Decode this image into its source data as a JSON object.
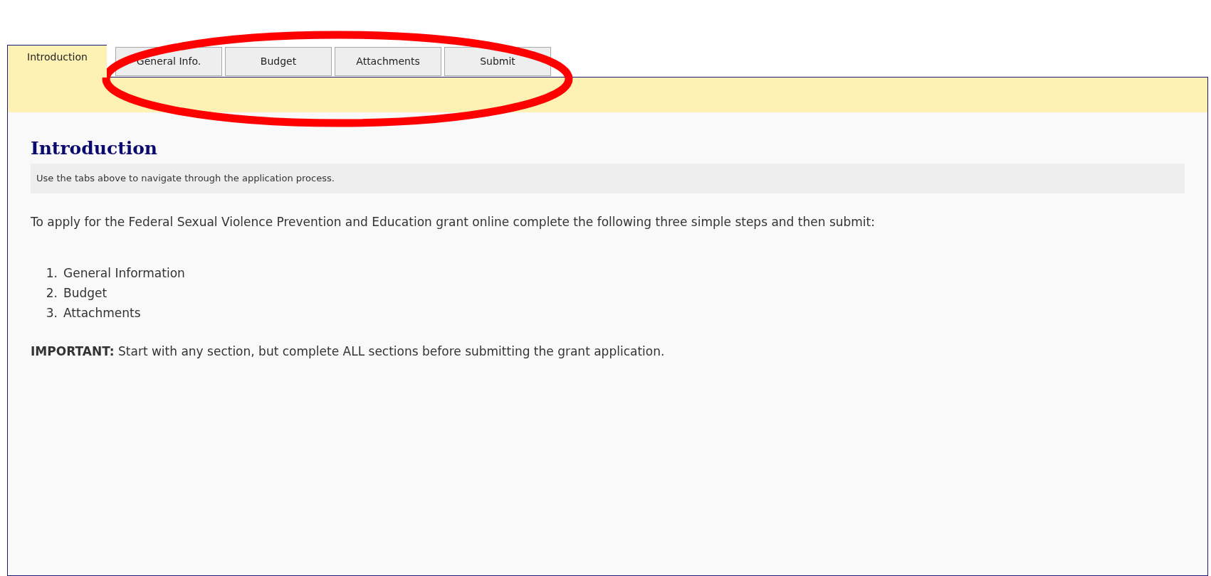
{
  "tabs": [
    {
      "label": "Introduction",
      "selected": true
    },
    {
      "label": "General Info.",
      "selected": false
    },
    {
      "label": "Budget",
      "selected": false
    },
    {
      "label": "Attachments",
      "selected": false
    },
    {
      "label": "Submit",
      "selected": false
    }
  ],
  "content": {
    "heading": "Introduction",
    "hint": "Use the tabs above to navigate through the application process.",
    "intro": "To apply for the Federal Sexual Violence Prevention and Education grant online complete the following three simple steps and then submit:",
    "steps": [
      {
        "number": "1.",
        "text": "General Information"
      },
      {
        "number": "2.",
        "text": "Budget"
      },
      {
        "number": "3.",
        "text": "Attachments"
      }
    ],
    "note": "**IMPORTANT:** Start with any section, but complete ALL sections before submitting the grant application."
  }
}
